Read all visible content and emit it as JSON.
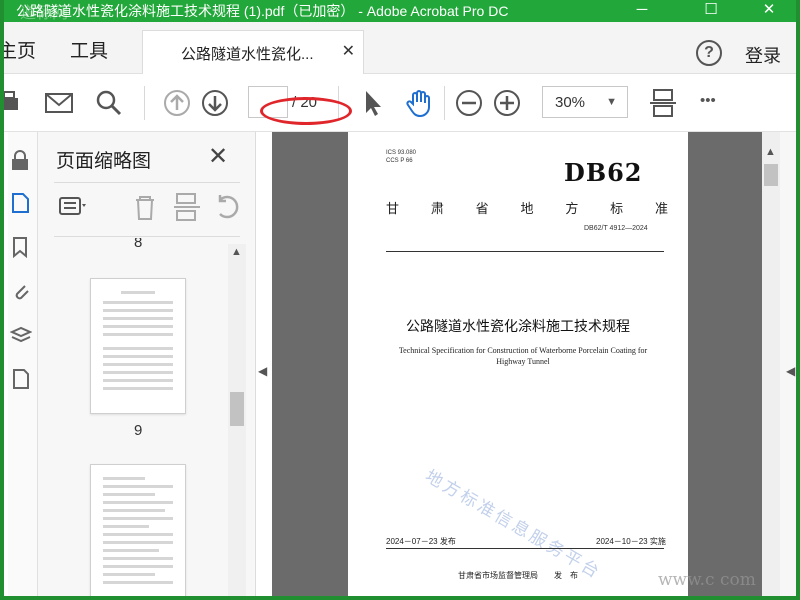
{
  "window": {
    "title": "公路隧道水性瓷化涂料施工技术规程 (1).pdf（已加密） - Adobe Acrobat Pro DC",
    "watermark_top": "道标网",
    "controls": [
      "─",
      "☐",
      "✕"
    ]
  },
  "tabs": {
    "home": "主页",
    "tools": "工具",
    "doc_tab": "公路隧道水性瓷化...",
    "doc_tab_close": "✕",
    "help": "?",
    "login": "登录"
  },
  "toolbar": {
    "page_current": "",
    "page_total": "/ 20",
    "zoom": "30%",
    "more": "•••"
  },
  "thumbnail_panel": {
    "title": "页面缩略图",
    "close": "✕",
    "page_numbers": [
      "8",
      "9"
    ]
  },
  "document": {
    "ics": "ICS  93.080",
    "ccs": "CCS  P 66",
    "db": "DB62",
    "standard_words": [
      "甘",
      "肃",
      "省",
      "地",
      "方",
      "标",
      "准"
    ],
    "code": "DB62/T 4912—2024",
    "title_cn": "公路隧道水性瓷化涂料施工技术规程",
    "title_en": "Technical Specification for Construction of Waterborne Porcelain Coating for Highway Tunnel",
    "watermark": "地方标准信息服务平台",
    "publish_date": "2024－07－23 发布",
    "implement_date": "2024－10－23 实施",
    "issuer": "甘肃省市场监督管理局　　发　布"
  },
  "corner_watermark": "www.c     com",
  "colors": {
    "titlebar": "#22a83a",
    "annotation": "#e0262b",
    "viewer_bg": "#6b6b6b",
    "hand_tool": "#1f6fd0"
  }
}
